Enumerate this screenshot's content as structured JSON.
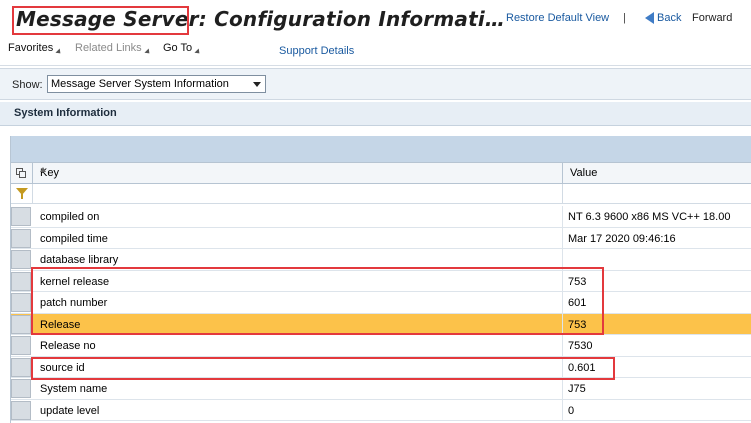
{
  "window": {
    "title": "Message Server: Configuration Informati…",
    "restore_label": "Restore Default View",
    "separator": "|",
    "back_label": "Back",
    "forward_label": "Forward"
  },
  "menu": {
    "favorites": "Favorites",
    "related_links": "Related Links",
    "go_to": "Go To",
    "support_details": "Support Details"
  },
  "show": {
    "label": "Show:",
    "selected": "Message Server System Information"
  },
  "section": {
    "title": "System Information"
  },
  "table": {
    "columns": [
      "Key",
      "Value"
    ],
    "rows": [
      {
        "key": "compiled on",
        "value": "NT 6.3 9600 x86 MS VC++ 18.00"
      },
      {
        "key": "compiled time",
        "value": "Mar 17 2020 09:46:16"
      },
      {
        "key": "database library",
        "value": ""
      },
      {
        "key": "kernel release",
        "value": "753"
      },
      {
        "key": "patch number",
        "value": "601"
      },
      {
        "key": "Release",
        "value": "753"
      },
      {
        "key": "Release no",
        "value": "7530"
      },
      {
        "key": "source id",
        "value": "0.601"
      },
      {
        "key": "System name",
        "value": "J75"
      },
      {
        "key": "update level",
        "value": "0"
      }
    ]
  },
  "colors": {
    "highlight_row": "#fcc24a",
    "annotation_red": "#e3393d",
    "link_blue": "#1a5aa0"
  }
}
